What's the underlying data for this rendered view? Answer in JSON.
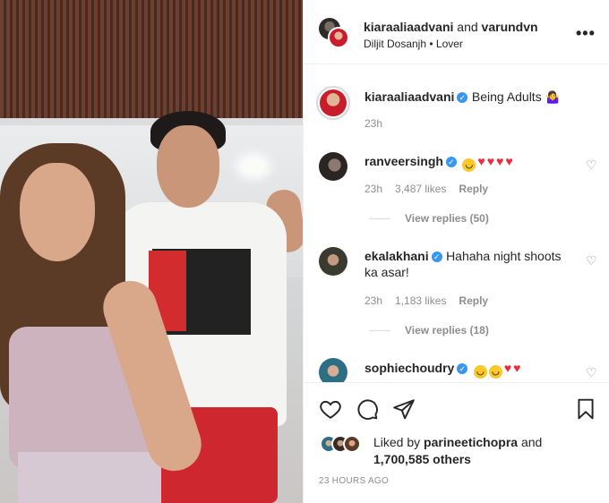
{
  "header": {
    "user_primary": "kiaraaliaadvani",
    "conjunction": "and",
    "user_secondary": "varundvn",
    "audio": "Diljit Dosanjh • Lover",
    "more_label": "•••"
  },
  "caption": {
    "username": "kiaraaliaadvani",
    "text": "Being Adults",
    "emoji": "🤷‍♀️",
    "time": "23h"
  },
  "comments": [
    {
      "username": "ranveersingh",
      "verified": true,
      "text": "",
      "emoji": [
        "laugh",
        "heart",
        "heart",
        "heart",
        "heart"
      ],
      "time": "23h",
      "likes": "3,487 likes",
      "reply": "Reply",
      "view_replies": "View replies (50)"
    },
    {
      "username": "ekalakhani",
      "verified": true,
      "text_line1": "Hahaha night shoots",
      "text_line2": "ka asar!",
      "time": "23h",
      "likes": "1,183 likes",
      "reply": "Reply",
      "view_replies": "View replies (18)"
    },
    {
      "username": "sophiechoudry",
      "verified": true,
      "emoji": [
        "laugh",
        "laugh",
        "heart",
        "heart"
      ]
    }
  ],
  "footer": {
    "liked_by_prefix": "Liked by",
    "liked_by_user": "parineetichopra",
    "liked_by_and": "and",
    "others": "1,700,585 others",
    "timestamp": "23 HOURS AGO"
  },
  "colors": {
    "heart": "#ed2b3d",
    "verified": "#3897f0",
    "meta": "#8e8e8e"
  }
}
